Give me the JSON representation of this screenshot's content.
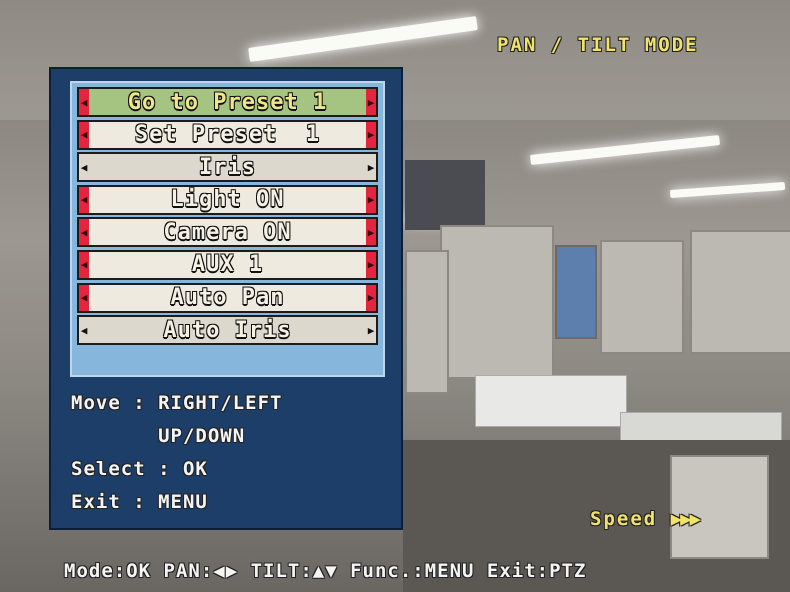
{
  "osd": {
    "mode_title": "PAN / TILT MODE",
    "speed_label": "Speed",
    "speed_indicator": "▶▶▶",
    "bottom_bar": "Mode:OK PAN:◀▶ TILT:▲▼ Func.:MENU Exit:PTZ"
  },
  "menu": {
    "items": [
      {
        "label": "Go to Preset 1",
        "state": "selected",
        "arrows": "red"
      },
      {
        "label": "Set Preset  1",
        "state": "normal",
        "arrows": "red"
      },
      {
        "label": "Iris",
        "state": "grey",
        "arrows": "plain"
      },
      {
        "label": "Light ON",
        "state": "normal",
        "arrows": "red"
      },
      {
        "label": "Camera ON",
        "state": "normal",
        "arrows": "red"
      },
      {
        "label": "AUX 1",
        "state": "normal",
        "arrows": "red"
      },
      {
        "label": "Auto Pan",
        "state": "normal",
        "arrows": "red"
      },
      {
        "label": "Auto Iris",
        "state": "grey",
        "arrows": "plain"
      }
    ],
    "arrow_left_glyph": "◀",
    "arrow_right_glyph": "▶"
  },
  "help": {
    "move_line1": "Move : RIGHT/LEFT",
    "move_line2": "       UP/DOWN",
    "select": "Select : OK",
    "exit": "Exit : MENU"
  },
  "colors": {
    "osd_yellow": "#f1e36a",
    "panel_blue": "#1c3e68",
    "list_blue": "#86b6dc",
    "selected_green": "#a6c481",
    "arrow_red": "#e2263e"
  }
}
